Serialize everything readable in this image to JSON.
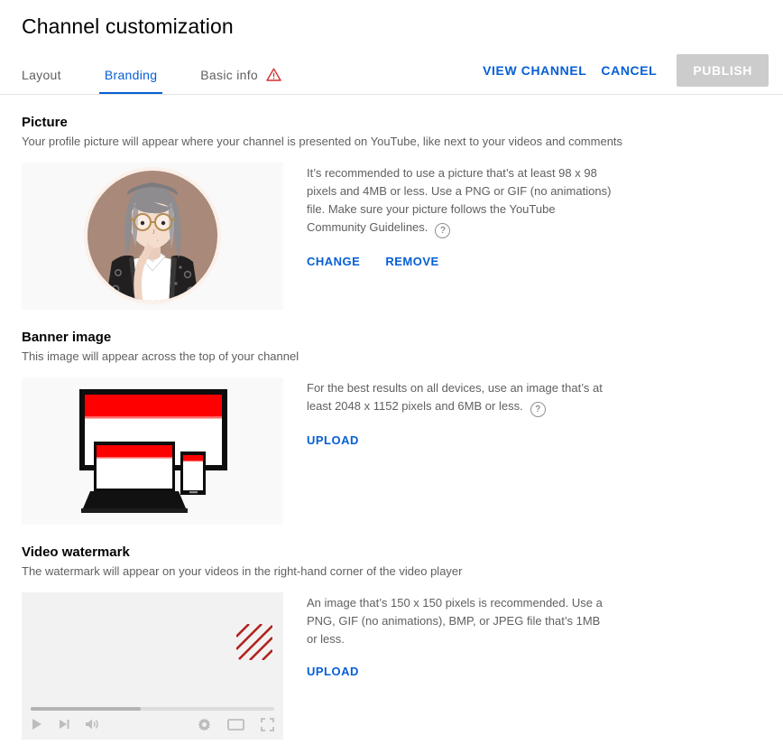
{
  "header": {
    "title": "Channel customization",
    "tabs": [
      {
        "label": "Layout",
        "active": false,
        "warning": false
      },
      {
        "label": "Branding",
        "active": true,
        "warning": false
      },
      {
        "label": "Basic info",
        "active": false,
        "warning": true
      }
    ],
    "actions": {
      "view_channel": "VIEW CHANNEL",
      "cancel": "CANCEL",
      "publish": "PUBLISH",
      "publish_disabled": true
    }
  },
  "colors": {
    "link_blue": "#065fd4",
    "warning_red": "#d32f2f",
    "youtube_red": "#ff0000",
    "watermark_red": "#b0231f",
    "panel_bg": "#f9f9f9",
    "player_bg": "#f2f2f2",
    "disabled_button": "#cccccc",
    "avatar_bg": "#a8897a"
  },
  "sections": {
    "picture": {
      "title": "Picture",
      "subtitle": "Your profile picture will appear where your channel is presented on YouTube, like next to your videos and comments",
      "info": "It’s recommended to use a picture that’s at least 98 x 98 pixels and 4MB or less. Use a PNG or GIF (no animations) file. Make sure your picture follows the YouTube Community Guidelines.",
      "help_glyph": "?",
      "buttons": [
        {
          "label": "CHANGE"
        },
        {
          "label": "REMOVE"
        }
      ]
    },
    "banner": {
      "title": "Banner image",
      "subtitle": "This image will appear across the top of your channel",
      "info": "For the best results on all devices, use an image that’s at least 2048 x 1152 pixels and 6MB or less.",
      "help_glyph": "?",
      "buttons": [
        {
          "label": "UPLOAD"
        }
      ]
    },
    "watermark": {
      "title": "Video watermark",
      "subtitle": "The watermark will appear on your videos in the right-hand corner of the video player",
      "info": "An image that’s 150 x 150 pixels is recommended. Use a PNG, GIF (no animations), BMP, or JPEG file that’s 1MB or less.",
      "buttons": [
        {
          "label": "UPLOAD"
        }
      ],
      "player": {
        "progress_percent": 45,
        "controls_left": [
          "play-icon",
          "next-icon",
          "volume-icon"
        ],
        "controls_right": [
          "settings-gear-icon",
          "miniplayer-icon",
          "fullscreen-icon"
        ]
      }
    }
  }
}
